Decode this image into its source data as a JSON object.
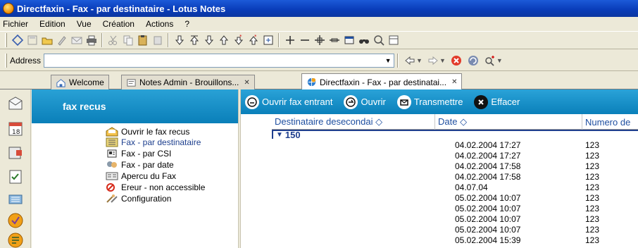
{
  "window": {
    "title": "Directfaxin - Fax - par destinataire - Lotus Notes"
  },
  "menu": [
    "Fichier",
    "Edition",
    "Vue",
    "Création",
    "Actions",
    "?"
  ],
  "address": {
    "label": "Address",
    "value": ""
  },
  "tabs": [
    {
      "label": "Welcome"
    },
    {
      "label": "Notes Admin - Brouillons..."
    },
    {
      "label": "Directfaxin - Fax - par destinatai..."
    }
  ],
  "navigator": {
    "header": "fax recus",
    "items": [
      {
        "label": "Ouvrir le fax recus",
        "icon": "envelope-icon"
      },
      {
        "label": "Fax - par destinataire",
        "icon": "list-icon"
      },
      {
        "label": "Fax - par CSI",
        "icon": "id-card-icon"
      },
      {
        "label": "Fax - par date",
        "icon": "calendar-people-icon"
      },
      {
        "label": "Apercu du Fax",
        "icon": "preview-icon"
      },
      {
        "label": "Ereur - non accessible",
        "icon": "error-icon"
      },
      {
        "label": "Configuration",
        "icon": "tools-icon"
      }
    ]
  },
  "actions": [
    {
      "label": "Ouvrir fax entrant"
    },
    {
      "label": "Ouvrir"
    },
    {
      "label": "Transmettre"
    },
    {
      "label": "Effacer"
    }
  ],
  "view": {
    "columns": [
      "Destinataire desecondai ◇",
      "Date ◇",
      "Numero de"
    ],
    "category": "150",
    "rows": [
      {
        "date": "04.02.2004 17:27",
        "num": "123"
      },
      {
        "date": "04.02.2004 17:27",
        "num": "123"
      },
      {
        "date": "04.02.2004 17:58",
        "num": "123"
      },
      {
        "date": "04.02.2004 17:58",
        "num": "123"
      },
      {
        "date": "04.07.04",
        "num": "123"
      },
      {
        "date": "05.02.2004 10:07",
        "num": "123"
      },
      {
        "date": "05.02.2004 10:07",
        "num": "123"
      },
      {
        "date": "05.02.2004 10:07",
        "num": "123"
      },
      {
        "date": "05.02.2004 10:07",
        "num": "123"
      },
      {
        "date": "05.02.2004 15:39",
        "num": "123"
      }
    ]
  },
  "colors": {
    "title_bar": "#0a3dba",
    "accent_blue": "#0f8bc4",
    "link_blue": "#1f4fa0"
  }
}
